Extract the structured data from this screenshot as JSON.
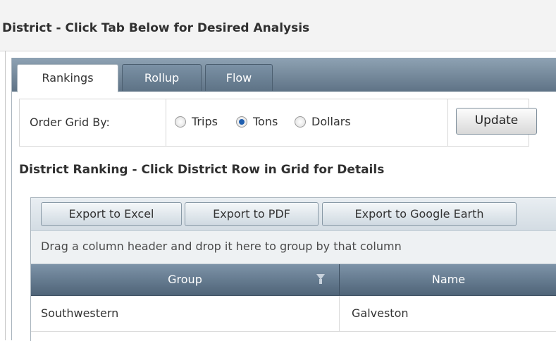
{
  "page": {
    "title": "District - Click Tab Below for Desired Analysis"
  },
  "tabs": [
    {
      "label": "Rankings",
      "active": true
    },
    {
      "label": "Rollup",
      "active": false
    },
    {
      "label": "Flow",
      "active": false
    }
  ],
  "order_grid": {
    "label": "Order Grid By:",
    "options": [
      {
        "label": "Trips",
        "checked": false
      },
      {
        "label": "Tons",
        "checked": true
      },
      {
        "label": "Dollars",
        "checked": false
      }
    ],
    "update_label": "Update"
  },
  "grid": {
    "caption": "District Ranking - Click District Row in Grid for Details",
    "toolbar": {
      "excel_label": "Export to Excel",
      "pdf_label": "Export to PDF",
      "google_earth_label": "Export to Google Earth"
    },
    "group_hint": "Drag a column header and drop it here to group by that column",
    "columns": [
      "Group",
      "Name"
    ],
    "rows": [
      {
        "group": "Southwestern",
        "name": "Galveston"
      }
    ]
  },
  "colors": {
    "tab_strip": "#6f8498",
    "header_bg": "#5f7488",
    "radio_checked": "#1f5fb0"
  }
}
